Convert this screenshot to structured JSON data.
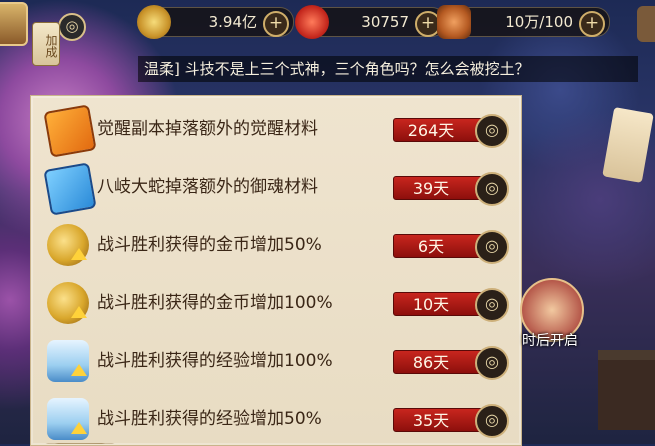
{
  "topbar": {
    "add_button_label": "加成",
    "resources": [
      {
        "name": "gold-coin",
        "value": "3.94亿"
      },
      {
        "name": "jade",
        "value": "30757"
      },
      {
        "name": "stamina",
        "value": "10万/100"
      }
    ],
    "plus_symbol": "+"
  },
  "chat": {
    "message": "温柔] 斗技不是上三个式神，三个角色吗？怎么会被挖土？"
  },
  "buffs": [
    {
      "label": "觉醒副本掉落额外的觉醒材料",
      "days": "264天",
      "icon": "red-talisman-scroll-icon"
    },
    {
      "label": "八岐大蛇掉落额外的御魂材料",
      "days": "39天",
      "icon": "blue-talisman-scroll-icon"
    },
    {
      "label": "战斗胜利获得的金币增加50%",
      "days": "6天",
      "icon": "gold-coins-up-icon"
    },
    {
      "label": "战斗胜利获得的金币增加100%",
      "days": "10天",
      "icon": "gold-coins-up-icon"
    },
    {
      "label": "战斗胜利获得的经验增加100%",
      "days": "86天",
      "icon": "exp-bottles-up-icon"
    },
    {
      "label": "战斗胜利获得的经验增加50%",
      "days": "35天",
      "icon": "exp-bottles-up-icon"
    }
  ],
  "event": {
    "label": "时后开启"
  },
  "colors": {
    "panel_bg": "#efe4cf",
    "days_badge": "#c8261e",
    "text_dark": "#3a2616"
  }
}
